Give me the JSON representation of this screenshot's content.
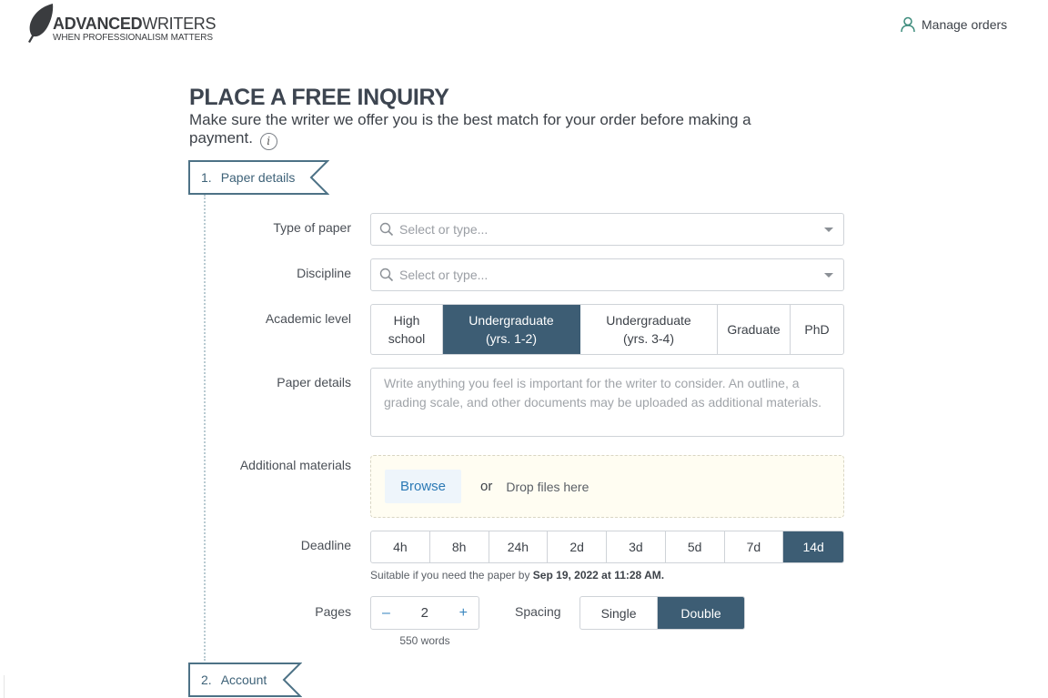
{
  "header": {
    "brand_bold": "ADVANCED",
    "brand_light": "WRITERS",
    "tagline": "WHEN PROFESSIONALISM MATTERS",
    "manage_orders": "Manage orders",
    "icons": {
      "logo": "feather-icon",
      "user": "user-icon"
    }
  },
  "intro": {
    "title": "PLACE A FREE INQUIRY",
    "subtitle": "Make sure the writer we offer you is the best match for your order before making a payment.",
    "info_glyph": "i"
  },
  "steps": [
    {
      "number": "1.",
      "label": "Paper details"
    },
    {
      "number": "2.",
      "label": "Account"
    }
  ],
  "form": {
    "type_of_paper": {
      "label": "Type of paper",
      "placeholder": "Select or type..."
    },
    "discipline": {
      "label": "Discipline",
      "placeholder": "Select or type..."
    },
    "academic_level": {
      "label": "Academic level",
      "options": [
        {
          "line1": "High",
          "line2": "school"
        },
        {
          "line1": "Undergraduate",
          "line2": "(yrs. 1-2)"
        },
        {
          "line1": "Undergraduate",
          "line2": "(yrs. 3-4)"
        },
        {
          "line1": "Graduate",
          "line2": ""
        },
        {
          "line1": "PhD",
          "line2": ""
        }
      ],
      "selected": "Undergraduate (yrs. 1-2)"
    },
    "paper_details": {
      "label": "Paper details",
      "placeholder": "Write anything you feel is important for the writer to consider. An outline, a grading scale, and other documents may be uploaded as additional materials."
    },
    "additional_materials": {
      "label": "Additional materials",
      "browse": "Browse",
      "or": "or",
      "drop": "Drop files here"
    },
    "deadline": {
      "label": "Deadline",
      "options": [
        "4h",
        "8h",
        "24h",
        "2d",
        "3d",
        "5d",
        "7d",
        "14d"
      ],
      "selected": "14d",
      "note_prefix": "Suitable if you need the paper by ",
      "note_date": "Sep 19, 2022 at 11:28 AM."
    },
    "pages": {
      "label": "Pages",
      "minus": "–",
      "plus": "+",
      "value": "2",
      "words": "550 words"
    },
    "spacing": {
      "label": "Spacing",
      "options": [
        "Single",
        "Double"
      ],
      "selected": "Double"
    }
  },
  "colors": {
    "primary": "#3d5d74",
    "link": "#2b79b5",
    "dropzone_bg": "#fffdf2",
    "ribbon": "#4d7286"
  }
}
